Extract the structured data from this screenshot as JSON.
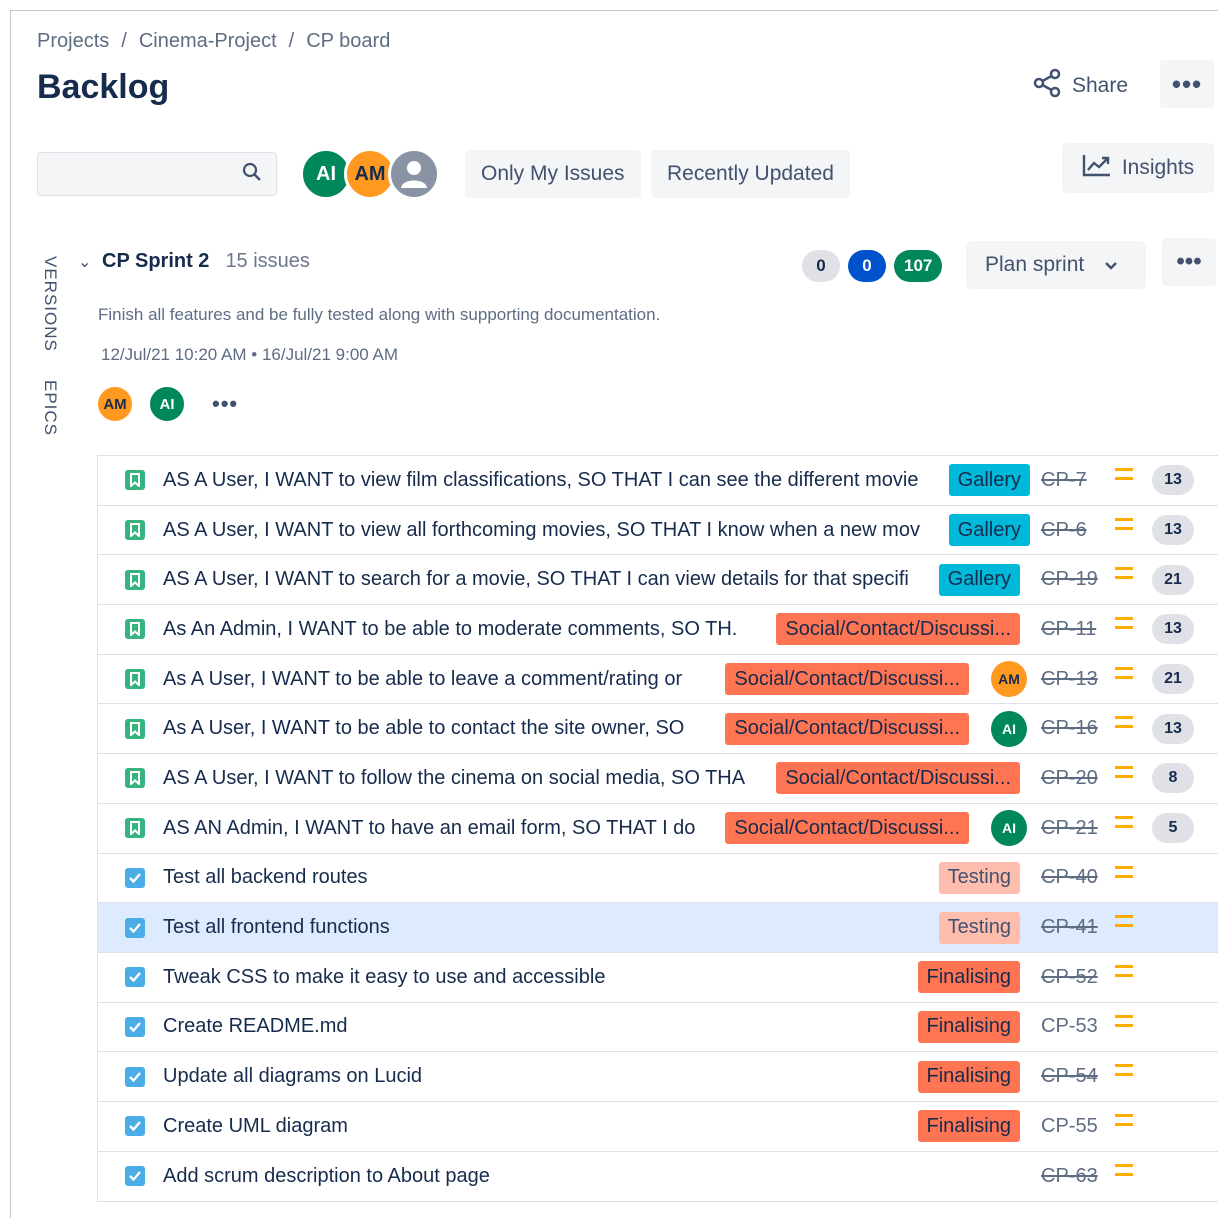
{
  "breadcrumb": [
    "Projects",
    "Cinema-Project",
    "CP board"
  ],
  "page_title": "Backlog",
  "header": {
    "share_label": "Share"
  },
  "search": {
    "placeholder": ""
  },
  "avatars": [
    {
      "initials": "AI",
      "color": "#00875a"
    },
    {
      "initials": "AM",
      "color": "#ff991f"
    },
    {
      "initials": "",
      "icon": "user-icon"
    }
  ],
  "filters": {
    "only_my_issues": "Only My Issues",
    "recently_updated": "Recently Updated"
  },
  "insights_label": "Insights",
  "side_tabs": [
    "VERSIONS",
    "EPICS"
  ],
  "sprint": {
    "name": "CP Sprint 2",
    "issue_count": "15 issues",
    "badges": [
      "0",
      "0",
      "107"
    ],
    "plan_label": "Plan sprint",
    "description": "Finish all features and be fully tested along with supporting documentation.",
    "dates": "12/Jul/21 10:20 AM • 16/Jul/21 9:00 AM",
    "people": [
      "AM",
      "AI"
    ]
  },
  "issues": [
    {
      "type": "story",
      "summary": "AS A User, I WANT to view film classifications, SO THAT I can see the different movie",
      "epic": "Gallery",
      "epic_kind": "gallery",
      "assignee": "",
      "key": "CP-7",
      "done": true,
      "points": "13"
    },
    {
      "type": "story",
      "summary": "AS A User, I WANT to view all forthcoming movies, SO THAT I know when a new mov",
      "epic": "Gallery",
      "epic_kind": "gallery",
      "assignee": "",
      "key": "CP-6",
      "done": true,
      "points": "13"
    },
    {
      "type": "story",
      "summary": "AS A User, I WANT to search for a movie, SO THAT I can view details for that specifi",
      "epic": "Gallery",
      "epic_kind": "gallery",
      "assignee": "",
      "key": "CP-19",
      "done": true,
      "points": "21"
    },
    {
      "type": "story",
      "summary": "As An Admin, I WANT to be able to moderate comments, SO TH.",
      "epic": "Social/Contact/Discussi...",
      "epic_kind": "social",
      "assignee": "",
      "key": "CP-11",
      "done": true,
      "points": "13"
    },
    {
      "type": "story",
      "summary": "As A User, I WANT to be able to leave a comment/rating or",
      "epic": "Social/Contact/Discussi...",
      "epic_kind": "social",
      "assignee": "AM",
      "key": "CP-13",
      "done": true,
      "points": "21"
    },
    {
      "type": "story",
      "summary": "As A User, I WANT to be able to contact the site owner, SO",
      "epic": "Social/Contact/Discussi...",
      "epic_kind": "social",
      "assignee": "AI",
      "key": "CP-16",
      "done": true,
      "points": "13"
    },
    {
      "type": "story",
      "summary": "AS A User, I WANT to follow the cinema on social media, SO THA",
      "epic": "Social/Contact/Discussi...",
      "epic_kind": "social",
      "assignee": "",
      "key": "CP-20",
      "done": true,
      "points": "8"
    },
    {
      "type": "story",
      "summary": "AS AN Admin, I WANT to have an email form, SO THAT I do",
      "epic": "Social/Contact/Discussi...",
      "epic_kind": "social",
      "assignee": "AI",
      "key": "CP-21",
      "done": true,
      "points": "5"
    },
    {
      "type": "task",
      "summary": "Test all backend routes",
      "epic": "Testing",
      "epic_kind": "testing",
      "assignee": "",
      "key": "CP-40",
      "done": true,
      "points": ""
    },
    {
      "type": "task",
      "summary": "Test all frontend functions",
      "epic": "Testing",
      "epic_kind": "testing",
      "assignee": "",
      "key": "CP-41",
      "done": true,
      "points": "",
      "selected": true
    },
    {
      "type": "task",
      "summary": "Tweak CSS to make it easy to use and accessible",
      "epic": "Finalising",
      "epic_kind": "final",
      "assignee": "",
      "key": "CP-52",
      "done": true,
      "points": ""
    },
    {
      "type": "task",
      "summary": "Create README.md",
      "epic": "Finalising",
      "epic_kind": "final",
      "assignee": "",
      "key": "CP-53",
      "done": false,
      "points": ""
    },
    {
      "type": "task",
      "summary": "Update all diagrams on Lucid",
      "epic": "Finalising",
      "epic_kind": "final",
      "assignee": "",
      "key": "CP-54",
      "done": true,
      "points": ""
    },
    {
      "type": "task",
      "summary": "Create UML diagram",
      "epic": "Finalising",
      "epic_kind": "final",
      "assignee": "",
      "key": "CP-55",
      "done": false,
      "points": ""
    },
    {
      "type": "task",
      "summary": "Add scrum description to About page",
      "epic": "",
      "epic_kind": "",
      "assignee": "",
      "key": "CP-63",
      "done": true,
      "points": ""
    }
  ],
  "icons": {
    "story": "story-icon",
    "task": "task-checkbox-icon",
    "priority": "medium-priority-icon"
  }
}
